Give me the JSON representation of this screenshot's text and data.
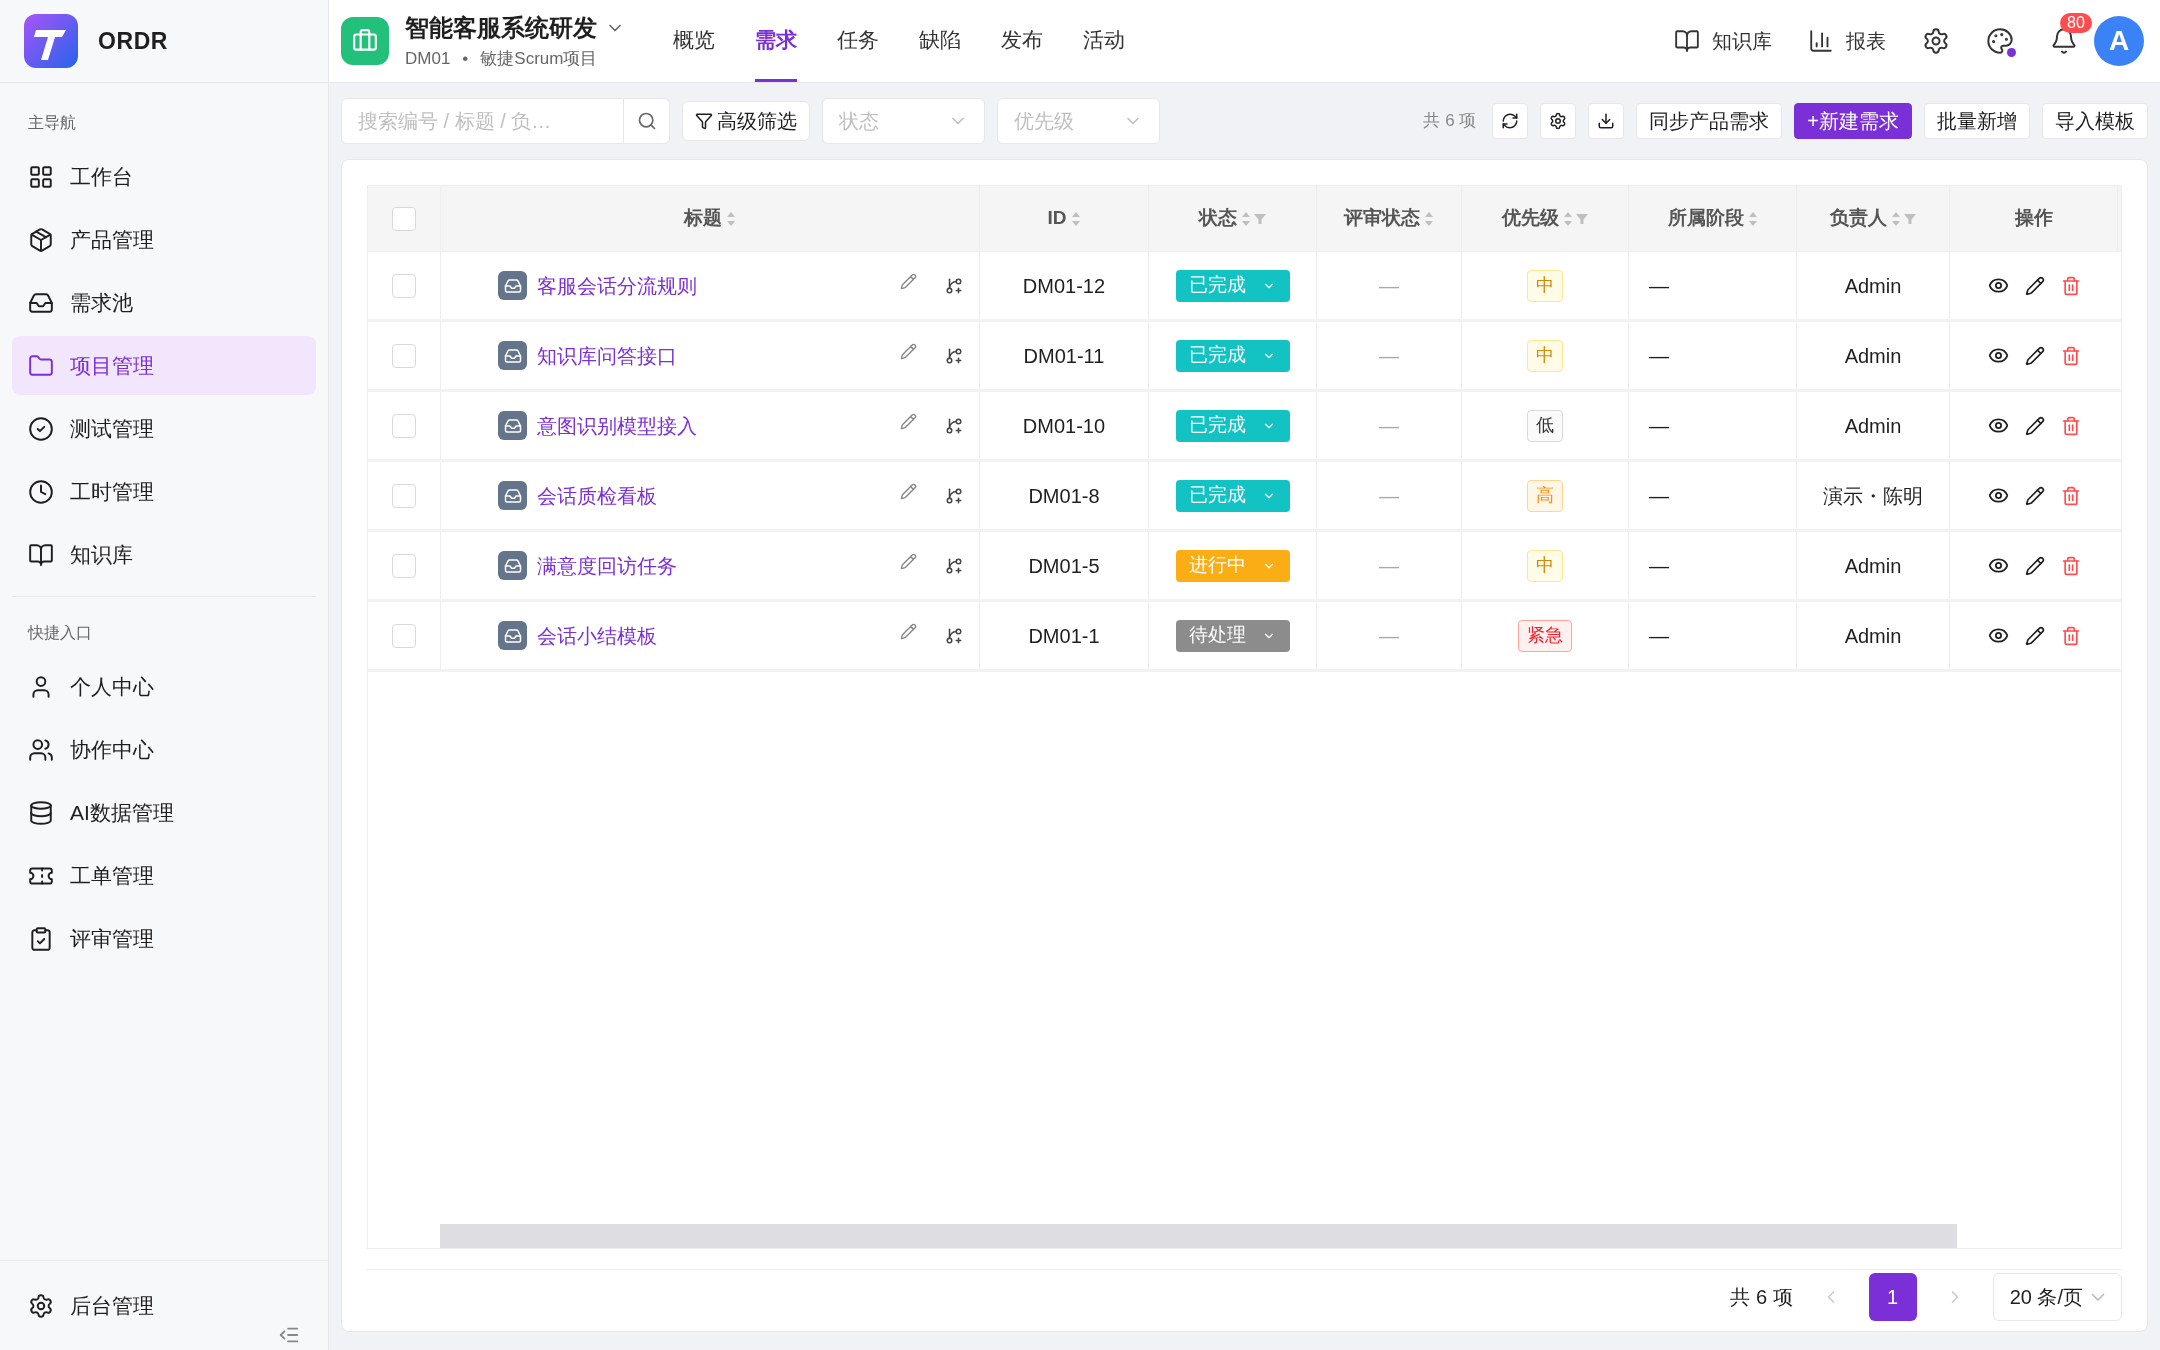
{
  "sidebar": {
    "logo": "ORDR",
    "sections": [
      {
        "title": "主导航",
        "items": [
          {
            "label": "工作台",
            "selected": false
          },
          {
            "label": "产品管理",
            "selected": false
          },
          {
            "label": "需求池",
            "selected": false
          },
          {
            "label": "项目管理",
            "selected": true
          },
          {
            "label": "测试管理",
            "selected": false
          },
          {
            "label": "工时管理",
            "selected": false
          },
          {
            "label": "知识库",
            "selected": false
          }
        ]
      },
      {
        "title": "快捷入口",
        "items": [
          {
            "label": "个人中心",
            "selected": false
          },
          {
            "label": "协作中心",
            "selected": false
          },
          {
            "label": "AI数据管理",
            "selected": false
          },
          {
            "label": "工单管理",
            "selected": false
          },
          {
            "label": "评审管理",
            "selected": false
          }
        ]
      }
    ],
    "footer": {
      "label": "后台管理"
    }
  },
  "project": {
    "name": "智能客服系统研发",
    "code": "DM01",
    "separator": "•",
    "type": "敏捷Scrum项目"
  },
  "tabs": [
    {
      "label": "概览",
      "selected": false
    },
    {
      "label": "需求",
      "selected": true
    },
    {
      "label": "任务",
      "selected": false
    },
    {
      "label": "缺陷",
      "selected": false
    },
    {
      "label": "发布",
      "selected": false
    },
    {
      "label": "活动",
      "selected": false
    }
  ],
  "header_links": [
    {
      "label": "知识库"
    },
    {
      "label": "报表"
    }
  ],
  "notifications": {
    "count": "80"
  },
  "avatar": {
    "initial": "A"
  },
  "toolbar": {
    "search_placeholder": "搜索编号 / 标题 / 负…",
    "advanced_filter": "高级筛选",
    "status_placeholder": "状态",
    "priority_placeholder": "优先级",
    "total": "共 6 项",
    "buttons": [
      {
        "label": "同步产品需求",
        "kind": "default"
      },
      {
        "label": "+新建需求",
        "kind": "primary"
      },
      {
        "label": "批量新增",
        "kind": "default"
      },
      {
        "label": "导入模板",
        "kind": "default"
      }
    ]
  },
  "table": {
    "all_checked": false,
    "columns": [
      {
        "label": "标题",
        "sortable": true,
        "filterable": false
      },
      {
        "label": "ID",
        "sortable": true,
        "filterable": false
      },
      {
        "label": "状态",
        "sortable": true,
        "filterable": true
      },
      {
        "label": "评审状态",
        "sortable": true,
        "filterable": false
      },
      {
        "label": "优先级",
        "sortable": true,
        "filterable": true
      },
      {
        "label": "所属阶段",
        "sortable": true,
        "filterable": false
      },
      {
        "label": "负责人",
        "sortable": true,
        "filterable": true
      },
      {
        "label": "操作",
        "sortable": false,
        "filterable": false
      }
    ],
    "rows": [
      {
        "checked": false,
        "title": "客服会话分流规则",
        "id": "DM01-12",
        "status": {
          "label": "已完成",
          "kind": "done"
        },
        "review": "—",
        "priority": {
          "label": "中",
          "kind": "medium"
        },
        "stage": "—",
        "owner": "Admin"
      },
      {
        "checked": false,
        "title": "知识库问答接口",
        "id": "DM01-11",
        "status": {
          "label": "已完成",
          "kind": "done"
        },
        "review": "—",
        "priority": {
          "label": "中",
          "kind": "medium"
        },
        "stage": "—",
        "owner": "Admin"
      },
      {
        "checked": false,
        "title": "意图识别模型接入",
        "id": "DM01-10",
        "status": {
          "label": "已完成",
          "kind": "done"
        },
        "review": "—",
        "priority": {
          "label": "低",
          "kind": "low"
        },
        "stage": "—",
        "owner": "Admin"
      },
      {
        "checked": false,
        "title": "会话质检看板",
        "id": "DM01-8",
        "status": {
          "label": "已完成",
          "kind": "done"
        },
        "review": "—",
        "priority": {
          "label": "高",
          "kind": "high"
        },
        "stage": "—",
        "owner": "演示・陈明"
      },
      {
        "checked": false,
        "title": "满意度回访任务",
        "id": "DM01-5",
        "status": {
          "label": "进行中",
          "kind": "in_progress"
        },
        "review": "—",
        "priority": {
          "label": "中",
          "kind": "medium"
        },
        "stage": "—",
        "owner": "Admin"
      },
      {
        "checked": false,
        "title": "会话小结模板",
        "id": "DM01-1",
        "status": {
          "label": "待处理",
          "kind": "pending"
        },
        "review": "—",
        "priority": {
          "label": "紧急",
          "kind": "urgent"
        },
        "stage": "—",
        "owner": "Admin"
      }
    ]
  },
  "pagination": {
    "total": "共 6 项",
    "pages": [
      {
        "label": "1",
        "selected": true
      }
    ],
    "page_size": "20 条/页"
  }
}
